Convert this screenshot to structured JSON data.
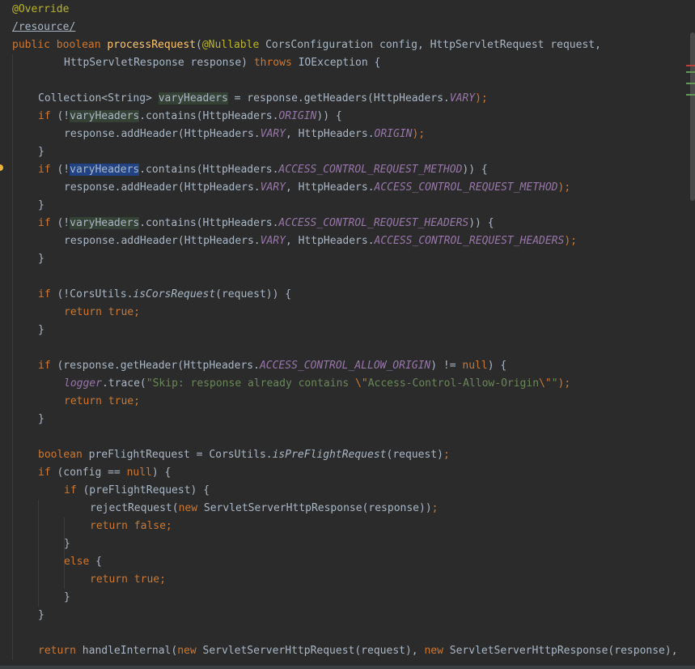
{
  "editor": {
    "lines": [
      {
        "indent": 0,
        "tokens": [
          {
            "t": "@Override",
            "c": "ann"
          }
        ]
      },
      {
        "indent": 0,
        "tokens": [
          {
            "t": "/resource/",
            "c": "path"
          }
        ]
      },
      {
        "indent": 0,
        "tokens": [
          {
            "t": "public ",
            "c": "kw"
          },
          {
            "t": "boolean ",
            "c": "kw"
          },
          {
            "t": "processRequest",
            "c": "fn"
          },
          {
            "t": "(",
            "c": "plain"
          },
          {
            "t": "@Nullable ",
            "c": "ann"
          },
          {
            "t": "CorsConfiguration config, HttpServletRequest request,",
            "c": "plain"
          }
        ]
      },
      {
        "indent": 2,
        "tokens": [
          {
            "t": "HttpServletResponse response) ",
            "c": "plain"
          },
          {
            "t": "throws ",
            "c": "kw"
          },
          {
            "t": "IOException {",
            "c": "plain"
          }
        ]
      },
      {
        "indent": 0,
        "tokens": []
      },
      {
        "indent": 1,
        "tokens": [
          {
            "t": "Collection<String> ",
            "c": "plain"
          },
          {
            "t": "varyHeaders",
            "c": "var-hl"
          },
          {
            "t": " = response.getHeaders(HttpHeaders.",
            "c": "plain"
          },
          {
            "t": "VARY",
            "c": "const"
          },
          {
            "t": ");",
            "c": "kw"
          }
        ]
      },
      {
        "indent": 1,
        "tokens": [
          {
            "t": "if ",
            "c": "kw"
          },
          {
            "t": "(!",
            "c": "plain"
          },
          {
            "t": "varyHeaders",
            "c": "var-hl"
          },
          {
            "t": ".contains(HttpHeaders.",
            "c": "plain"
          },
          {
            "t": "ORIGIN",
            "c": "const"
          },
          {
            "t": ")) {",
            "c": "plain"
          }
        ]
      },
      {
        "indent": 2,
        "tokens": [
          {
            "t": "response.addHeader(HttpHeaders.",
            "c": "plain"
          },
          {
            "t": "VARY",
            "c": "const"
          },
          {
            "t": ", HttpHeaders.",
            "c": "plain"
          },
          {
            "t": "ORIGIN",
            "c": "const"
          },
          {
            "t": ");",
            "c": "kw"
          }
        ]
      },
      {
        "indent": 1,
        "tokens": [
          {
            "t": "}",
            "c": "plain"
          }
        ]
      },
      {
        "indent": 1,
        "tokens": [
          {
            "t": "if ",
            "c": "kw"
          },
          {
            "t": "(!",
            "c": "plain"
          },
          {
            "t": "varyHeaders",
            "c": "var-caret"
          },
          {
            "t": ".contains(HttpHeaders.",
            "c": "plain"
          },
          {
            "t": "ACCESS_CONTROL_REQUEST_METHOD",
            "c": "const"
          },
          {
            "t": ")) {",
            "c": "plain"
          }
        ]
      },
      {
        "indent": 2,
        "tokens": [
          {
            "t": "response.addHeader(HttpHeaders.",
            "c": "plain"
          },
          {
            "t": "VARY",
            "c": "const"
          },
          {
            "t": ", HttpHeaders.",
            "c": "plain"
          },
          {
            "t": "ACCESS_CONTROL_REQUEST_METHOD",
            "c": "const"
          },
          {
            "t": ");",
            "c": "kw"
          }
        ]
      },
      {
        "indent": 1,
        "tokens": [
          {
            "t": "}",
            "c": "plain"
          }
        ]
      },
      {
        "indent": 1,
        "tokens": [
          {
            "t": "if ",
            "c": "kw"
          },
          {
            "t": "(!",
            "c": "plain"
          },
          {
            "t": "varyHeaders",
            "c": "var-hl"
          },
          {
            "t": ".contains(HttpHeaders.",
            "c": "plain"
          },
          {
            "t": "ACCESS_CONTROL_REQUEST_HEADERS",
            "c": "const"
          },
          {
            "t": ")) {",
            "c": "plain"
          }
        ]
      },
      {
        "indent": 2,
        "tokens": [
          {
            "t": "response.addHeader(HttpHeaders.",
            "c": "plain"
          },
          {
            "t": "VARY",
            "c": "const"
          },
          {
            "t": ", HttpHeaders.",
            "c": "plain"
          },
          {
            "t": "ACCESS_CONTROL_REQUEST_HEADERS",
            "c": "const"
          },
          {
            "t": ");",
            "c": "kw"
          }
        ]
      },
      {
        "indent": 1,
        "tokens": [
          {
            "t": "}",
            "c": "plain"
          }
        ]
      },
      {
        "indent": 0,
        "tokens": []
      },
      {
        "indent": 1,
        "tokens": [
          {
            "t": "if ",
            "c": "kw"
          },
          {
            "t": "(!CorsUtils.",
            "c": "plain"
          },
          {
            "t": "isCorsRequest",
            "c": "static"
          },
          {
            "t": "(request)) {",
            "c": "plain"
          }
        ]
      },
      {
        "indent": 2,
        "tokens": [
          {
            "t": "return ",
            "c": "kw"
          },
          {
            "t": "true;",
            "c": "kw"
          }
        ]
      },
      {
        "indent": 1,
        "tokens": [
          {
            "t": "}",
            "c": "plain"
          }
        ]
      },
      {
        "indent": 0,
        "tokens": []
      },
      {
        "indent": 1,
        "tokens": [
          {
            "t": "if ",
            "c": "kw"
          },
          {
            "t": "(response.getHeader(HttpHeaders.",
            "c": "plain"
          },
          {
            "t": "ACCESS_CONTROL_ALLOW_ORIGIN",
            "c": "const"
          },
          {
            "t": ") != ",
            "c": "plain"
          },
          {
            "t": "null",
            "c": "kw"
          },
          {
            "t": ") {",
            "c": "plain"
          }
        ]
      },
      {
        "indent": 2,
        "tokens": [
          {
            "t": "logger",
            "c": "const"
          },
          {
            "t": ".trace(",
            "c": "plain"
          },
          {
            "t": "\"Skip: response already contains ",
            "c": "str"
          },
          {
            "t": "\\\"",
            "c": "kw"
          },
          {
            "t": "Access-Control-Allow-Origin",
            "c": "str"
          },
          {
            "t": "\\\"",
            "c": "kw"
          },
          {
            "t": "\"",
            "c": "str"
          },
          {
            "t": ");",
            "c": "kw"
          }
        ]
      },
      {
        "indent": 2,
        "tokens": [
          {
            "t": "return ",
            "c": "kw"
          },
          {
            "t": "true;",
            "c": "kw"
          }
        ]
      },
      {
        "indent": 1,
        "tokens": [
          {
            "t": "}",
            "c": "plain"
          }
        ]
      },
      {
        "indent": 0,
        "tokens": []
      },
      {
        "indent": 1,
        "tokens": [
          {
            "t": "boolean ",
            "c": "kw"
          },
          {
            "t": "preFlightRequest = CorsUtils.",
            "c": "plain"
          },
          {
            "t": "isPreFlightRequest",
            "c": "static"
          },
          {
            "t": "(request)",
            "c": "plain"
          },
          {
            "t": ";",
            "c": "kw"
          }
        ]
      },
      {
        "indent": 1,
        "tokens": [
          {
            "t": "if ",
            "c": "kw"
          },
          {
            "t": "(config == ",
            "c": "plain"
          },
          {
            "t": "null",
            "c": "kw"
          },
          {
            "t": ") {",
            "c": "plain"
          }
        ]
      },
      {
        "indent": 2,
        "tokens": [
          {
            "t": "if ",
            "c": "kw"
          },
          {
            "t": "(preFlightRequest) {",
            "c": "plain"
          }
        ]
      },
      {
        "indent": 3,
        "tokens": [
          {
            "t": "rejectRequest(",
            "c": "plain"
          },
          {
            "t": "new ",
            "c": "kw"
          },
          {
            "t": "ServletServerHttpResponse(response))",
            "c": "plain"
          },
          {
            "t": ";",
            "c": "kw"
          }
        ]
      },
      {
        "indent": 3,
        "tokens": [
          {
            "t": "return ",
            "c": "kw"
          },
          {
            "t": "false;",
            "c": "kw"
          }
        ]
      },
      {
        "indent": 2,
        "tokens": [
          {
            "t": "}",
            "c": "plain"
          }
        ]
      },
      {
        "indent": 2,
        "tokens": [
          {
            "t": "else ",
            "c": "kw"
          },
          {
            "t": "{",
            "c": "plain"
          }
        ]
      },
      {
        "indent": 3,
        "tokens": [
          {
            "t": "return ",
            "c": "kw"
          },
          {
            "t": "true;",
            "c": "kw"
          }
        ]
      },
      {
        "indent": 2,
        "tokens": [
          {
            "t": "}",
            "c": "plain"
          }
        ]
      },
      {
        "indent": 1,
        "tokens": [
          {
            "t": "}",
            "c": "plain"
          }
        ]
      },
      {
        "indent": 0,
        "tokens": []
      },
      {
        "indent": 1,
        "tokens": [
          {
            "t": "return ",
            "c": "kw"
          },
          {
            "t": "handleInternal(",
            "c": "plain"
          },
          {
            "t": "new ",
            "c": "kw"
          },
          {
            "t": "ServletServerHttpRequest(request), ",
            "c": "plain"
          },
          {
            "t": "new ",
            "c": "kw"
          },
          {
            "t": "ServletServerHttpResponse(response),",
            "c": "plain"
          }
        ]
      }
    ],
    "caret_line": 9,
    "gutter_icon": "lightbulb-icon",
    "colors": {
      "background": "#2b2b2b",
      "keyword": "#cc7832",
      "annotation": "#bbb529",
      "method": "#ffc66d",
      "constant": "#9876aa",
      "string": "#6a8759",
      "text": "#a9b7c6",
      "usage_highlight": "#344134",
      "caret_highlight": "#214283"
    }
  }
}
